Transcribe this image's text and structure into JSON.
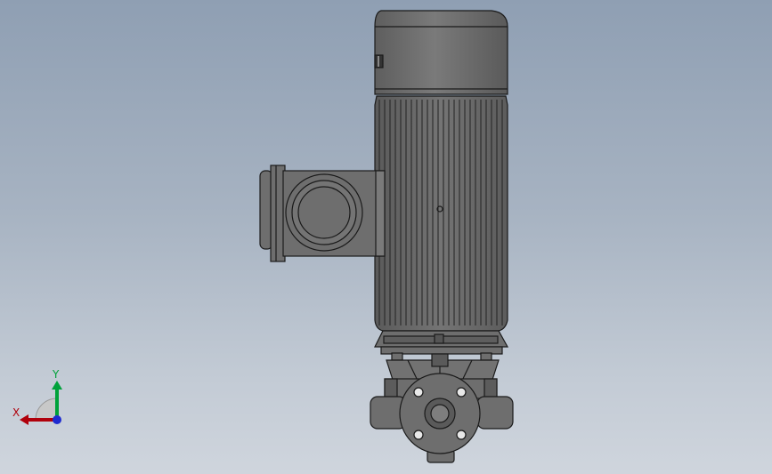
{
  "triad": {
    "x_label": "X",
    "y_label": "Y",
    "x_color": "#b0000b",
    "y_color": "#00a23a",
    "z_color": "#1e2bd0"
  },
  "model": {
    "body_color": "#6e6e6e",
    "edge_color": "#1a1a1a",
    "highlight_color": "#8a8a8a",
    "icon": "vertical-inline-pump-icon"
  }
}
